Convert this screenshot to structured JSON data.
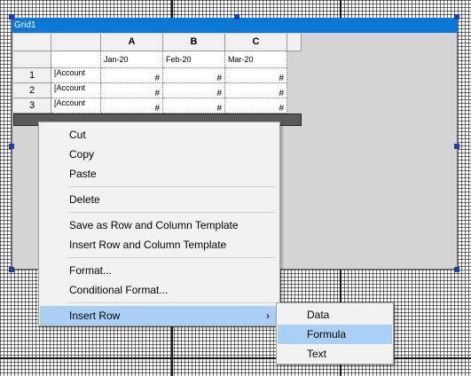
{
  "grid": {
    "title": "Grid1",
    "columns": [
      "A",
      "B",
      "C"
    ],
    "dates": [
      "Jan-20",
      "Feb-20",
      "Mar-20"
    ],
    "rows": [
      {
        "num": "1",
        "label": "[Account",
        "values": [
          "#",
          "#",
          "#"
        ]
      },
      {
        "num": "2",
        "label": "[Account",
        "values": [
          "#",
          "#",
          "#"
        ]
      },
      {
        "num": "3",
        "label": "[Account",
        "values": [
          "#",
          "#",
          "#"
        ]
      }
    ]
  },
  "context_menu": {
    "items": [
      {
        "label": "Cut"
      },
      {
        "label": "Copy"
      },
      {
        "label": "Paste"
      },
      {
        "label": "Delete"
      },
      {
        "label": "Save as Row and Column Template"
      },
      {
        "label": "Insert Row and Column Template"
      },
      {
        "label": "Format..."
      },
      {
        "label": "Conditional Format..."
      },
      {
        "label": "Insert Row",
        "submenu_arrow": "›"
      }
    ],
    "highlighted_item": "Insert Row"
  },
  "submenu": {
    "items": [
      {
        "label": "Data"
      },
      {
        "label": "Formula"
      },
      {
        "label": "Text"
      }
    ],
    "highlighted_item": "Formula"
  },
  "colors": {
    "titlebar": "#0a78d7",
    "highlight": "#a9cff4",
    "handles": "#1e3cb4"
  }
}
